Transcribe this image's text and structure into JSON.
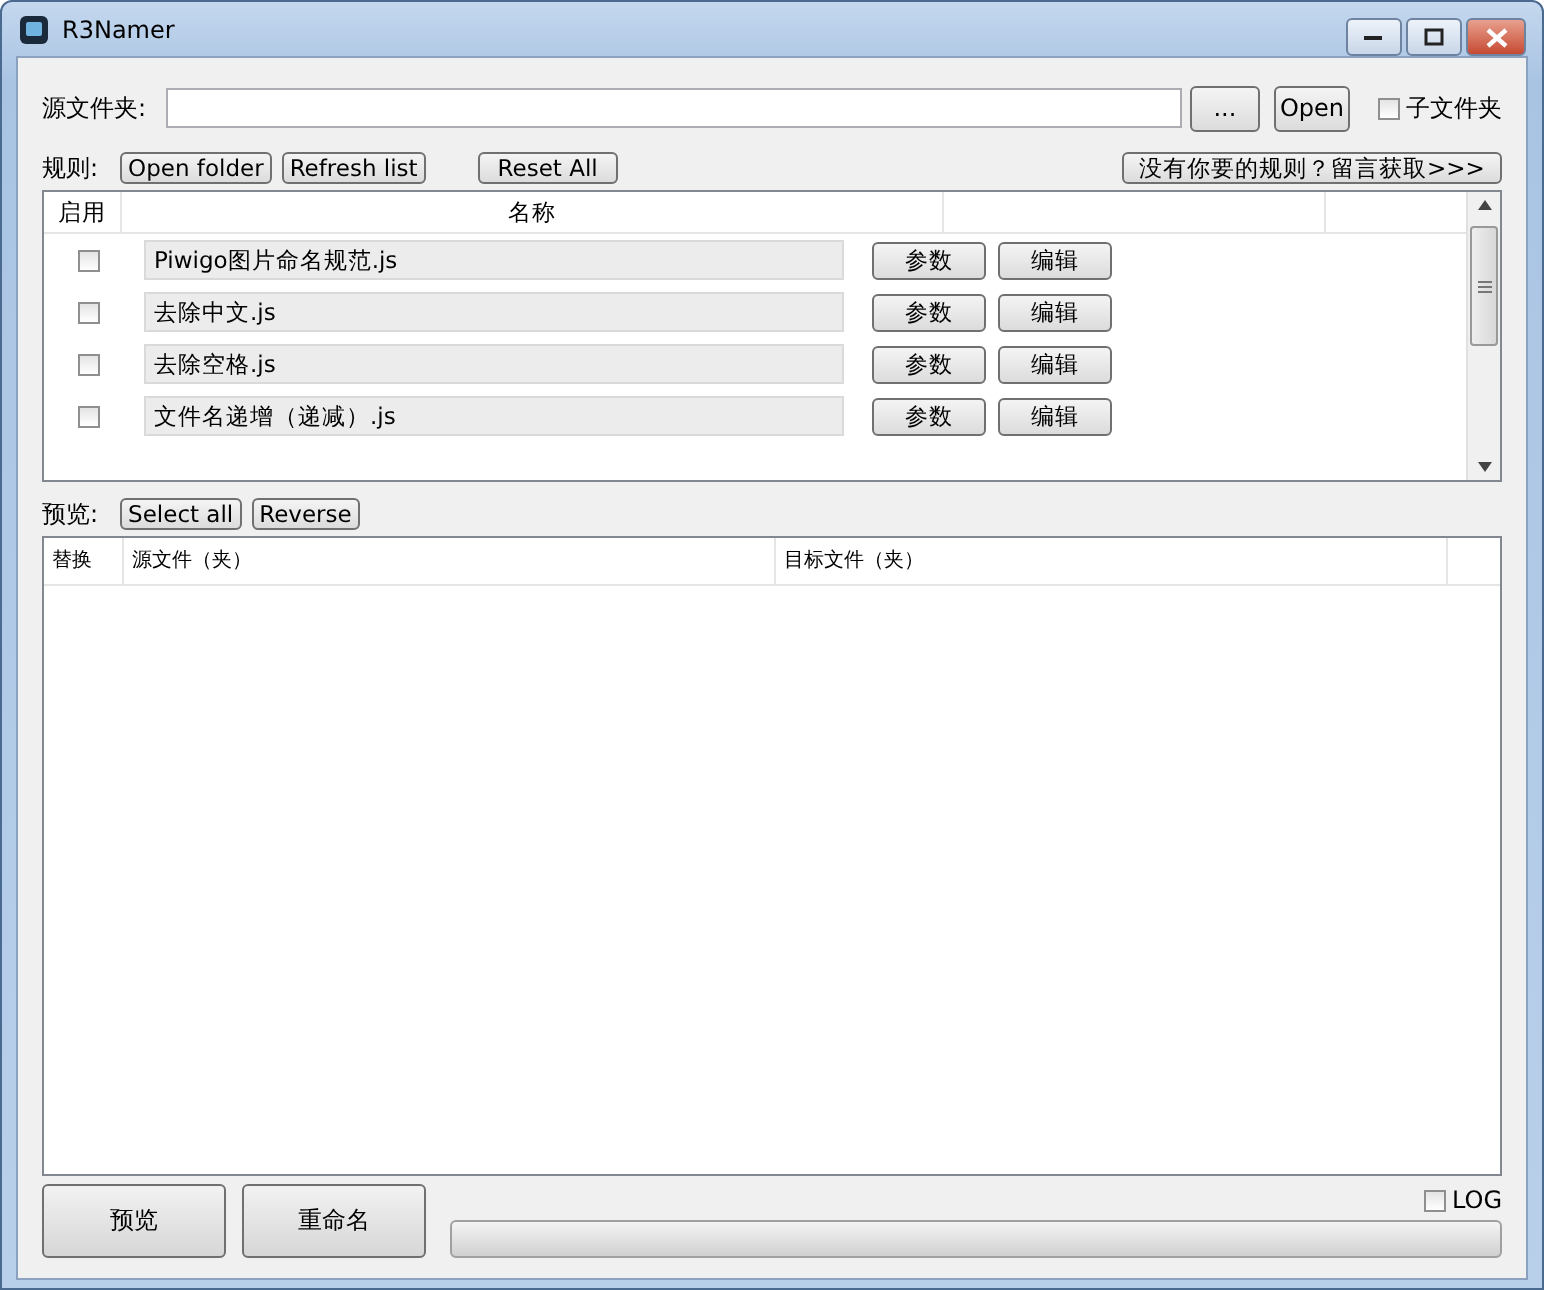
{
  "window": {
    "title": "R3Namer"
  },
  "source": {
    "label": "源文件夹:",
    "browse_button": "...",
    "open_button": "Open",
    "subfolder": {
      "label": "子文件夹",
      "checked": false
    }
  },
  "rules_bar": {
    "label": "规则:",
    "buttons": [
      "Open folder",
      "Refresh list",
      "Reset All"
    ],
    "more_button": "没有你要的规则？留言获取>>>"
  },
  "rules_table": {
    "columns": [
      "启用",
      "名称"
    ],
    "rows": [
      {
        "enabled": false,
        "name": "Piwigo图片命名规范.js",
        "params_button": "参数",
        "edit_button": "编辑"
      },
      {
        "enabled": false,
        "name": "去除中文.js",
        "params_button": "参数",
        "edit_button": "编辑"
      },
      {
        "enabled": false,
        "name": "去除空格.js",
        "params_button": "参数",
        "edit_button": "编辑"
      },
      {
        "enabled": false,
        "name": "文件名递增（递减）.js",
        "params_button": "参数",
        "edit_button": "编辑"
      }
    ]
  },
  "preview_bar": {
    "label": "预览:",
    "buttons": [
      "Select all",
      "Reverse"
    ]
  },
  "preview_table": {
    "columns": [
      "替换",
      "源文件（夹）",
      "目标文件（夹）"
    ]
  },
  "bottom": {
    "preview_button": "预览",
    "rename_button": "重命名",
    "log": {
      "label": "LOG",
      "checked": false
    },
    "progress": {
      "level": 0
    }
  }
}
